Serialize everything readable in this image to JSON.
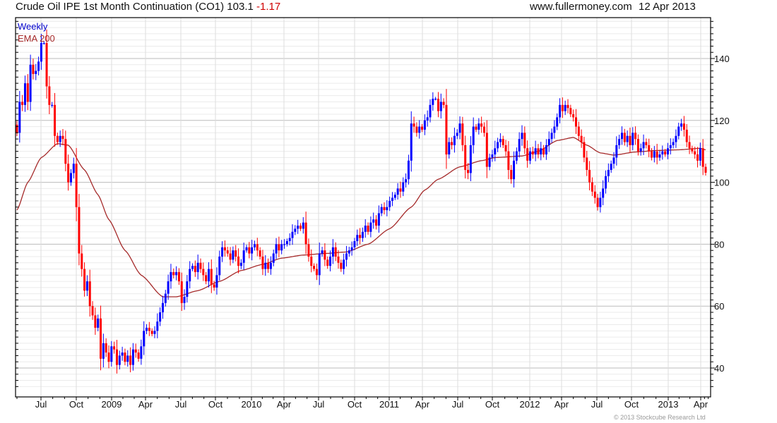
{
  "header": {
    "title": "Crude Oil IPE 1st Month Continuation (CO1) 103.1",
    "change": "-1.17",
    "site": "www.fullermoney.com",
    "date": "12 Apr 2013"
  },
  "footer": {
    "copyright": "© 2013 Stockcube Research Ltd"
  },
  "colors": {
    "up": "#0000ff",
    "down": "#ff0000",
    "ema": "#a52a2a",
    "legend_weekly": "#0000cc",
    "legend_ema": "#a52a2a"
  },
  "chart_data": {
    "type": "candlestick",
    "title": "Crude Oil IPE 1st Month Continuation (CO1)",
    "legend": [
      "Weekly",
      "EMA 200"
    ],
    "legend_position": "top-left",
    "y_axis_side": "right",
    "ylim": [
      33,
      153
    ],
    "y_ticks": [
      40,
      60,
      80,
      100,
      120,
      140
    ],
    "x_tick_labels": [
      "Jul",
      "Oct",
      "2009",
      "Apr",
      "Jul",
      "Oct",
      "2010",
      "Apr",
      "Jul",
      "Oct",
      "2011",
      "Apr",
      "Jul",
      "Oct",
      "2012",
      "Apr",
      "Jul",
      "Oct",
      "2013",
      "Apr"
    ],
    "grid": true,
    "weekly_close": [
      116,
      126,
      125,
      132,
      126,
      138,
      135,
      136,
      139,
      145,
      145,
      131,
      125,
      125,
      115,
      113,
      115,
      114,
      106,
      100,
      103,
      106,
      92,
      77,
      72,
      65,
      68,
      60,
      57,
      53,
      56,
      43,
      48,
      45,
      42,
      47,
      46,
      41,
      44,
      45,
      42,
      44,
      41,
      46,
      45,
      43,
      47,
      52,
      53,
      52,
      51,
      52,
      55,
      58,
      61,
      64,
      68,
      71,
      70,
      71,
      68,
      61,
      63,
      68,
      72,
      73,
      71,
      74,
      72,
      70,
      68,
      72,
      67,
      66,
      70,
      76,
      79,
      78,
      77,
      75,
      78,
      76,
      73,
      74,
      78,
      79,
      77,
      79,
      80,
      78,
      76,
      72,
      74,
      72,
      74,
      77,
      80,
      78,
      80,
      80,
      81,
      82,
      84,
      85,
      86,
      85,
      87,
      80,
      76,
      73,
      72,
      70,
      77,
      78,
      75,
      73,
      76,
      79,
      76,
      74,
      72,
      75,
      77,
      78,
      79,
      81,
      83,
      82,
      84,
      86,
      84,
      87,
      88,
      86,
      90,
      92,
      91,
      92,
      94,
      95,
      96,
      98,
      97,
      100,
      101,
      107,
      119,
      118,
      116,
      118,
      117,
      120,
      121,
      125,
      127,
      127,
      123,
      126,
      125,
      109,
      113,
      112,
      115,
      116,
      119,
      112,
      104,
      103,
      112,
      118,
      117,
      119,
      118,
      116,
      105,
      108,
      109,
      111,
      113,
      114,
      112,
      110,
      104,
      101,
      107,
      110,
      114,
      116,
      111,
      107,
      110,
      109,
      111,
      109,
      111,
      109,
      112,
      114,
      116,
      118,
      121,
      125,
      123,
      125,
      124,
      122,
      121,
      118,
      115,
      113,
      108,
      104,
      100,
      97,
      95,
      92,
      95,
      98,
      102,
      104,
      106,
      108,
      112,
      114,
      116,
      113,
      115,
      112,
      116,
      114,
      110,
      111,
      113,
      112,
      110,
      108,
      110,
      108,
      109,
      110,
      109,
      111,
      112,
      113,
      115,
      118,
      119,
      117,
      113,
      111,
      110,
      109,
      107,
      111,
      105,
      103.1
    ],
    "ema_200_by_week": [
      [
        0,
        91
      ],
      [
        4,
        100
      ],
      [
        9,
        108
      ],
      [
        15,
        112.5
      ],
      [
        19,
        112
      ],
      [
        25,
        104
      ],
      [
        30,
        96
      ],
      [
        34,
        88
      ],
      [
        40,
        78
      ],
      [
        46,
        70
      ],
      [
        54,
        63
      ],
      [
        59,
        63
      ],
      [
        67,
        65
      ],
      [
        75,
        68
      ],
      [
        83,
        71.5
      ],
      [
        91,
        73.5
      ],
      [
        98,
        75.5
      ],
      [
        106,
        76.5
      ],
      [
        114,
        77
      ],
      [
        122,
        77.5
      ],
      [
        130,
        80
      ],
      [
        138,
        85
      ],
      [
        146,
        92
      ],
      [
        151,
        97.5
      ],
      [
        156,
        101
      ],
      [
        164,
        105
      ],
      [
        172,
        107
      ],
      [
        177,
        108
      ],
      [
        187,
        108.5
      ],
      [
        193,
        110
      ],
      [
        200,
        113.5
      ],
      [
        206,
        114.5
      ],
      [
        211,
        112
      ],
      [
        216,
        109.5
      ],
      [
        221,
        108.8
      ],
      [
        229,
        109.8
      ],
      [
        237,
        110.3
      ],
      [
        245,
        110.5
      ],
      [
        253,
        111
      ],
      [
        255,
        110.5
      ]
    ]
  }
}
